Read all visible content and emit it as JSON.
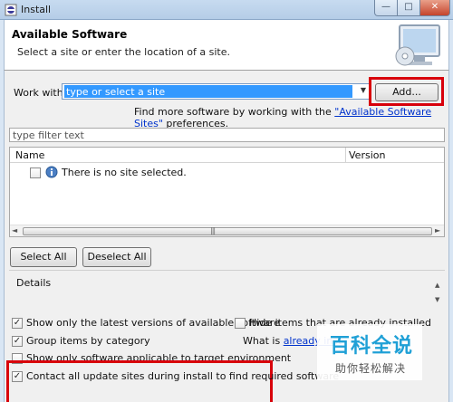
{
  "window": {
    "title": "Install",
    "minimize_glyph": "—",
    "maximize_glyph": "□",
    "close_glyph": "✕"
  },
  "header": {
    "title": "Available Software",
    "subtitle": "Select a site or enter the location of a site."
  },
  "work_with": {
    "label": "Work with:",
    "placeholder": "type or select a site",
    "add_label": "Add...",
    "more_prefix": "Find more software by working with the ",
    "more_link": "\"Available Software Sites\"",
    "more_suffix": " preferences."
  },
  "filter": {
    "placeholder": "type filter text"
  },
  "table": {
    "columns": [
      "Name",
      "Version"
    ],
    "rows": [
      {
        "checked": false,
        "text": "There is no site selected."
      }
    ]
  },
  "buttons": {
    "select_all": "Select All",
    "deselect_all": "Deselect All"
  },
  "details": {
    "label": "Details"
  },
  "options": {
    "latest": {
      "label": "Show only the latest versions of available software",
      "checked": true
    },
    "group": {
      "label": "Group items by category",
      "checked": true
    },
    "target": {
      "label": "Show only software applicable to target environment",
      "checked": false
    },
    "contact": {
      "label": "Contact all update sites during install to find required software",
      "checked": true
    },
    "hide": {
      "label": "Hide items that are already installed",
      "checked": false
    },
    "whatis_prefix": "What is ",
    "whatis_link": "already inst"
  },
  "watermark": {
    "title": "百科全说",
    "subtitle": "助你轻松解决"
  },
  "colors": {
    "highlight": "#d8000b",
    "link": "#0033cc",
    "selection": "#3399ff"
  }
}
